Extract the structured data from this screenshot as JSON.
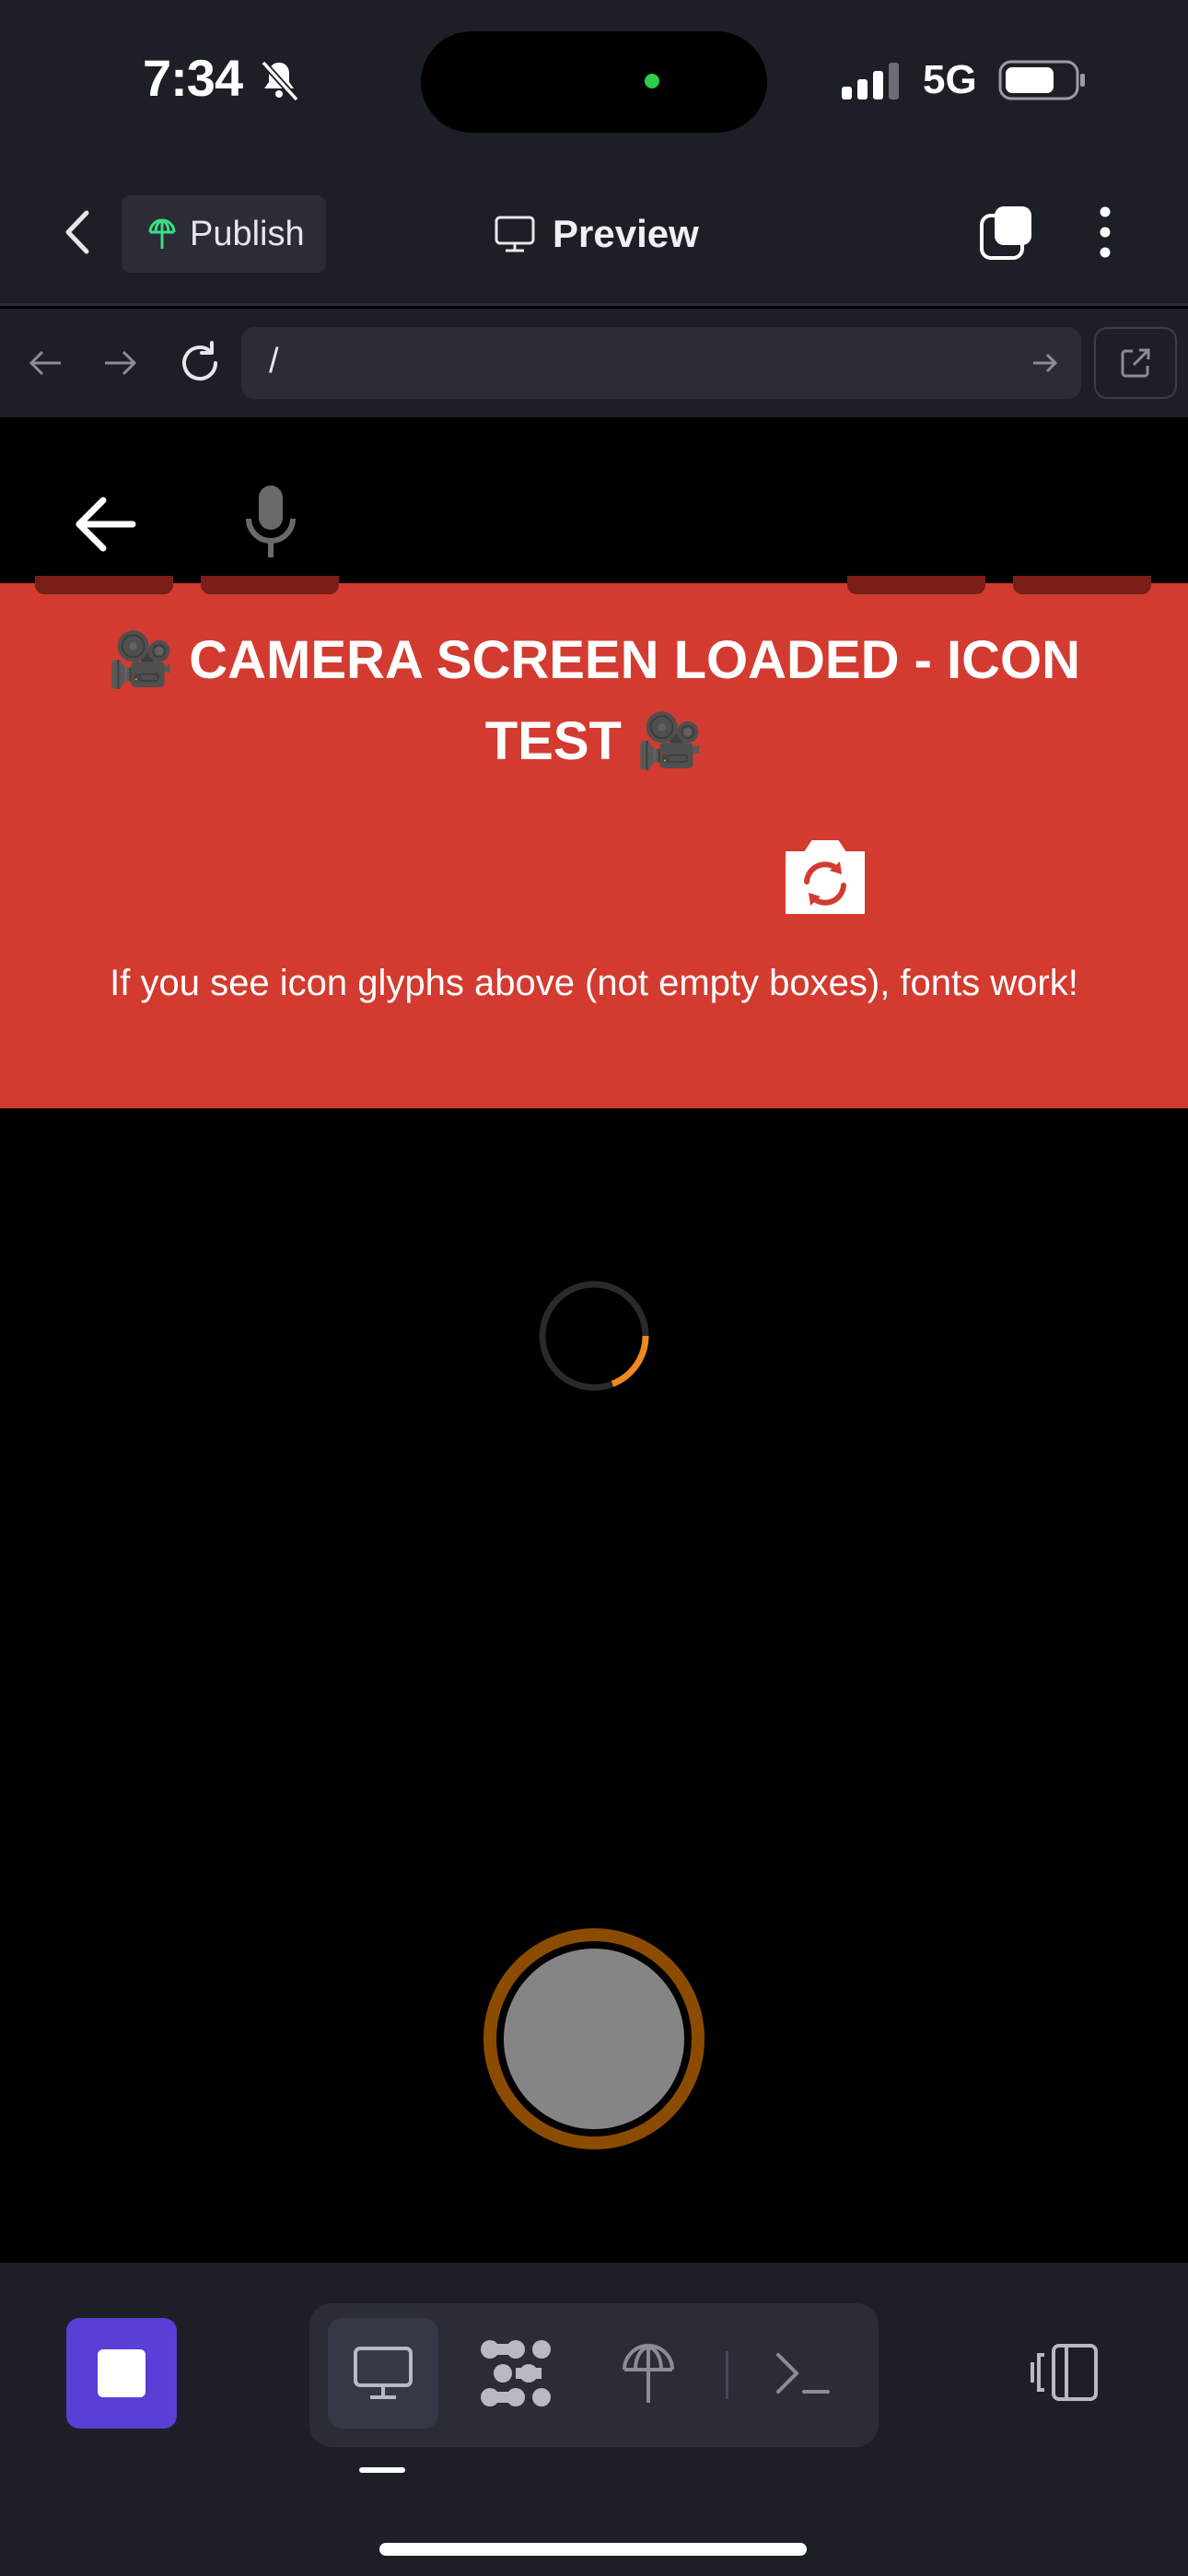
{
  "status_bar": {
    "time": "7:34",
    "network": "5G",
    "icons": [
      "bell-slash-icon",
      "signal-icon",
      "battery-icon"
    ]
  },
  "toolbar": {
    "publish_label": "Publish",
    "preview_label": "Preview",
    "icons": [
      "chevron-left-icon",
      "umbrella-antenna-icon",
      "monitor-icon",
      "tabs-icon",
      "more-vertical-icon"
    ]
  },
  "address_bar": {
    "url": "/",
    "icons": [
      "arrow-left-icon",
      "arrow-right-icon",
      "reload-icon",
      "go-arrow-icon",
      "external-link-icon"
    ]
  },
  "app": {
    "banner_title": "🎥 CAMERA SCREEN LOADED - ICON TEST 🎥",
    "banner_note": "If you see icon glyphs above (not empty boxes), fonts work!",
    "icons": [
      "back-arrow-icon",
      "microphone-icon",
      "camera-switch-icon",
      "loading-spinner-icon",
      "shutter-button"
    ]
  },
  "bottom_bar": {
    "tools": [
      "monitor-icon",
      "dots-grid-icon",
      "deploy-icon",
      "terminal-icon"
    ],
    "active_tool": "monitor-icon"
  },
  "colors": {
    "chrome_bg": "#1d1f26",
    "banner_red": "#d33b30",
    "accent_purple": "#5a3fd6",
    "spinner_orange": "#f08a1c",
    "shutter_ring": "#8c4c00"
  }
}
